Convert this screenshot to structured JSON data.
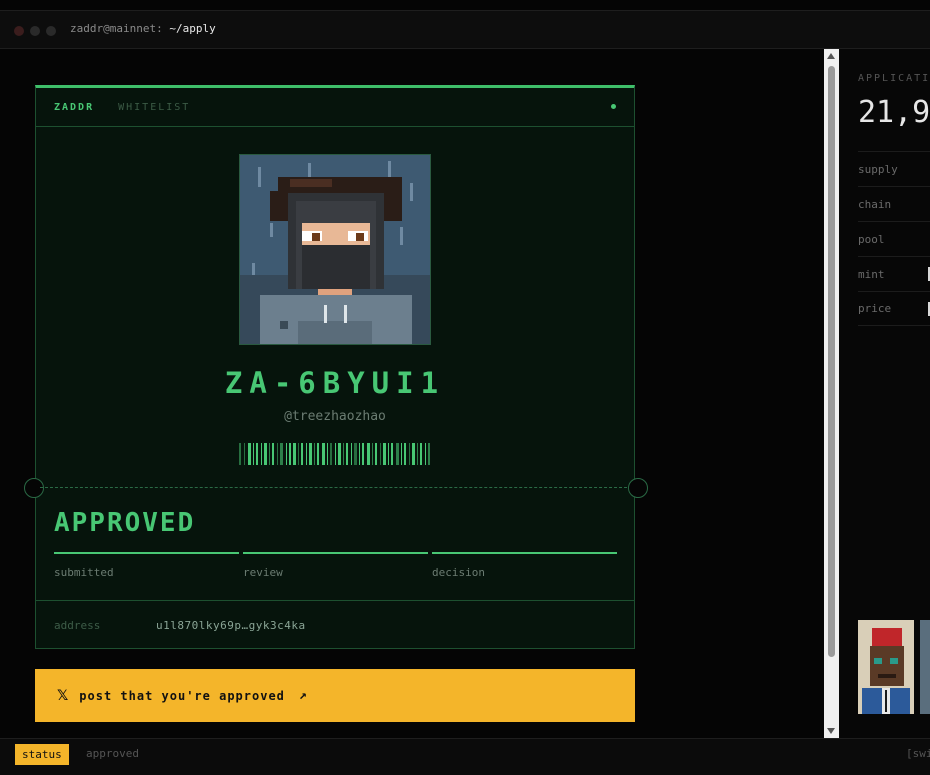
{
  "window": {
    "user_host": "zaddr@mainnet:",
    "path": "~/apply"
  },
  "card": {
    "brand": "ZADDR",
    "section": "WHITELIST",
    "id": "ZA-6BYUI1",
    "handle": "@treezhaozhao",
    "status": "APPROVED",
    "steps": [
      "submitted",
      "review",
      "decision"
    ],
    "address_label": "address",
    "address_value": "u1l870lky69p…gyk3c4ka"
  },
  "cta": {
    "label": "post that you're approved",
    "icon_left": "x-logo-icon",
    "icon_right": "arrow-up-right-icon"
  },
  "side": {
    "heading": "APPLICATI",
    "count": "21,9",
    "rows": [
      "supply",
      "chain",
      "pool",
      "mint",
      "price"
    ]
  },
  "statusbar": {
    "chip": "status",
    "value": "approved",
    "hint": "[swi"
  },
  "colors": {
    "accent_green": "#48c774",
    "cta_yellow": "#f4b52a",
    "card_bg": "#06140c"
  }
}
